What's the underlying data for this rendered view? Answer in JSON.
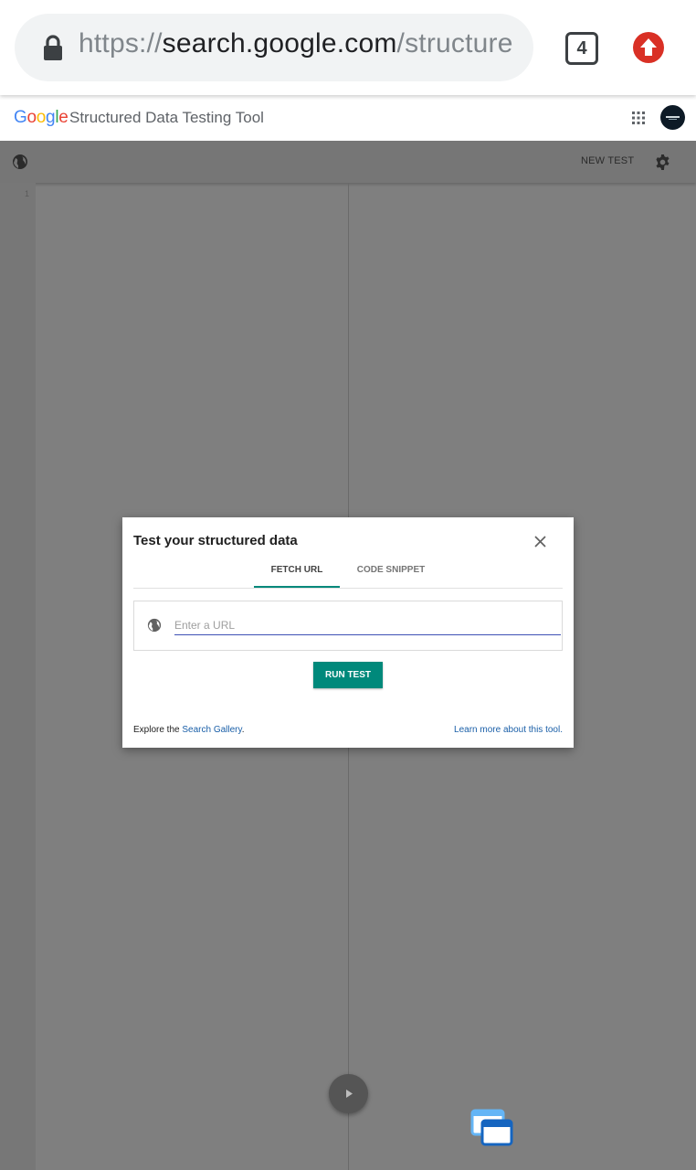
{
  "browser": {
    "url": {
      "scheme": "https://",
      "host": "search.google.com",
      "path": "/structure"
    },
    "tab_count": "4",
    "icons": [
      "lock-icon",
      "tab-counter",
      "update-arrow-icon"
    ],
    "update_color": "#d93025"
  },
  "app": {
    "logo_letters": [
      "G",
      "o",
      "o",
      "g",
      "l",
      "e"
    ],
    "logo_colors": [
      "#4285f4",
      "#ea4335",
      "#fbbc05",
      "#4285f4",
      "#34a853",
      "#ea4335"
    ],
    "title": "Structured Data Testing Tool"
  },
  "toolbar": {
    "new_test_label": "NEW TEST",
    "icons": [
      "globe-icon",
      "gear-icon"
    ]
  },
  "editor": {
    "line_numbers": [
      "1"
    ]
  },
  "dialog": {
    "title": "Test your structured data",
    "tabs": [
      {
        "label": "FETCH URL",
        "active": true
      },
      {
        "label": "CODE SNIPPET",
        "active": false
      }
    ],
    "url_input": {
      "placeholder": "Enter a URL",
      "value": ""
    },
    "run_button": "RUN TEST",
    "footer": {
      "explore_prefix": "Explore the ",
      "explore_link": "Search Gallery",
      "explore_suffix": ".",
      "learn_more": "Learn more about this tool."
    },
    "accent_color": "#00897b",
    "input_underline_color": "#3f51b5",
    "link_color": "#1a5fa8"
  },
  "overlay": {
    "icons": [
      "play-icon",
      "floating-window-icon"
    ]
  }
}
